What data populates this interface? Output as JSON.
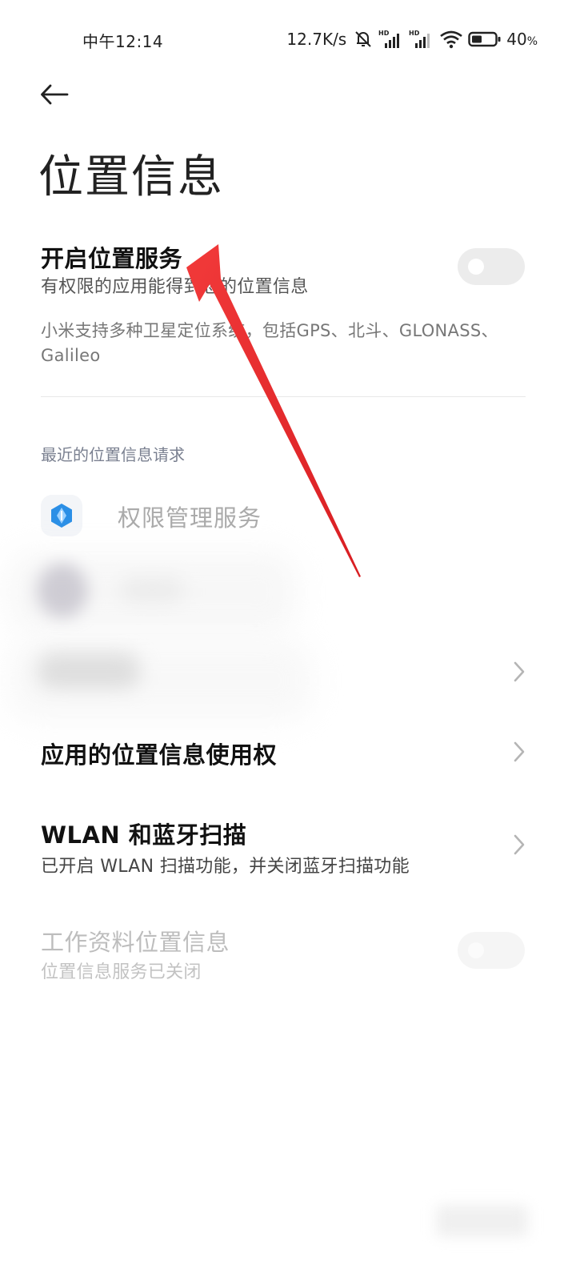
{
  "status_bar": {
    "time": "中午12:14",
    "net_speed": "12.7K/s",
    "battery_value": "40",
    "battery_unit": "%",
    "icons": [
      "mute-icon",
      "hd-signal-icon",
      "hd-signal-icon",
      "wifi-icon",
      "battery-icon"
    ]
  },
  "header": {
    "back_icon": "arrow-left-icon",
    "title": "位置信息"
  },
  "location_service": {
    "title": "开启位置服务",
    "subtitle": "有权限的应用能得到您的位置信息",
    "enabled": false,
    "note": "小米支持多种卫星定位系统，包括GPS、北斗、GLONASS、Galileo"
  },
  "recent_requests": {
    "header": "最近的位置信息请求",
    "apps": [
      {
        "name": "权限管理服务",
        "icon": "permission-service-icon"
      }
    ]
  },
  "app_permissions": {
    "title": "应用的位置信息使用权"
  },
  "wlan_bt_scan": {
    "title": "WLAN 和蓝牙扫描",
    "subtitle": "已开启 WLAN 扫描功能，并关闭蓝牙扫描功能"
  },
  "work_profile": {
    "title": "工作资料位置信息",
    "subtitle": "位置信息服务已关闭",
    "enabled": false
  },
  "colors": {
    "annotation_arrow": "#e8262a",
    "app_icon_blue": "#2b8fe6",
    "toggle_off": "#ececec"
  }
}
